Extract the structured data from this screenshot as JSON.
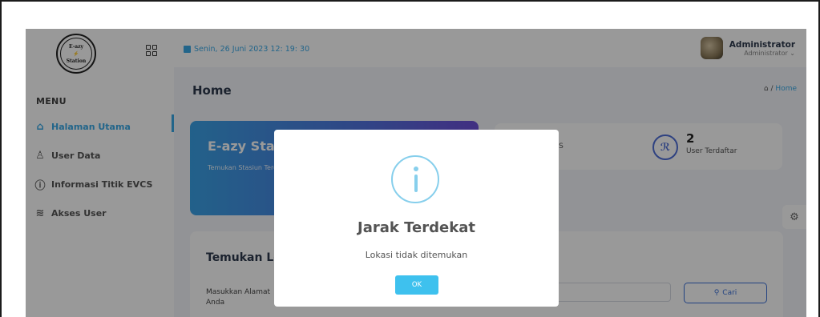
{
  "sidebar": {
    "logo_text": "E-azy Station",
    "menu_label": "MENU",
    "items": [
      {
        "label": "Halaman Utama",
        "icon": "home-icon"
      },
      {
        "label": "User Data",
        "icon": "users-icon"
      },
      {
        "label": "Informasi Titik EVCS",
        "icon": "info-icon"
      },
      {
        "label": "Akses User",
        "icon": "layers-icon"
      }
    ]
  },
  "topbar": {
    "date": "Senin, 26 Juni 2023  12: 19: 30",
    "user_name": "Administrator",
    "user_role": "Administrator ⌄"
  },
  "page": {
    "title": "Home",
    "breadcrumb_sep": "/",
    "breadcrumb_current": "Home"
  },
  "hero": {
    "title": "E-azy Sta",
    "subtitle": "Temukan Stasiun Terdekatmu"
  },
  "stats": [
    {
      "label": "EVCS"
    },
    {
      "value": "2",
      "label": "User Terdaftar"
    }
  ],
  "search": {
    "title": "Temukan Lo",
    "label": "Masukkan Alamat Anda",
    "button": "Cari"
  },
  "modal": {
    "title": "Jarak Terdekat",
    "message": "Lokasi tidak ditemukan",
    "ok": "OK"
  },
  "colors": {
    "accent": "#3aa9e6",
    "ok_button": "#3ec1ee",
    "info_icon": "#87cfec"
  }
}
